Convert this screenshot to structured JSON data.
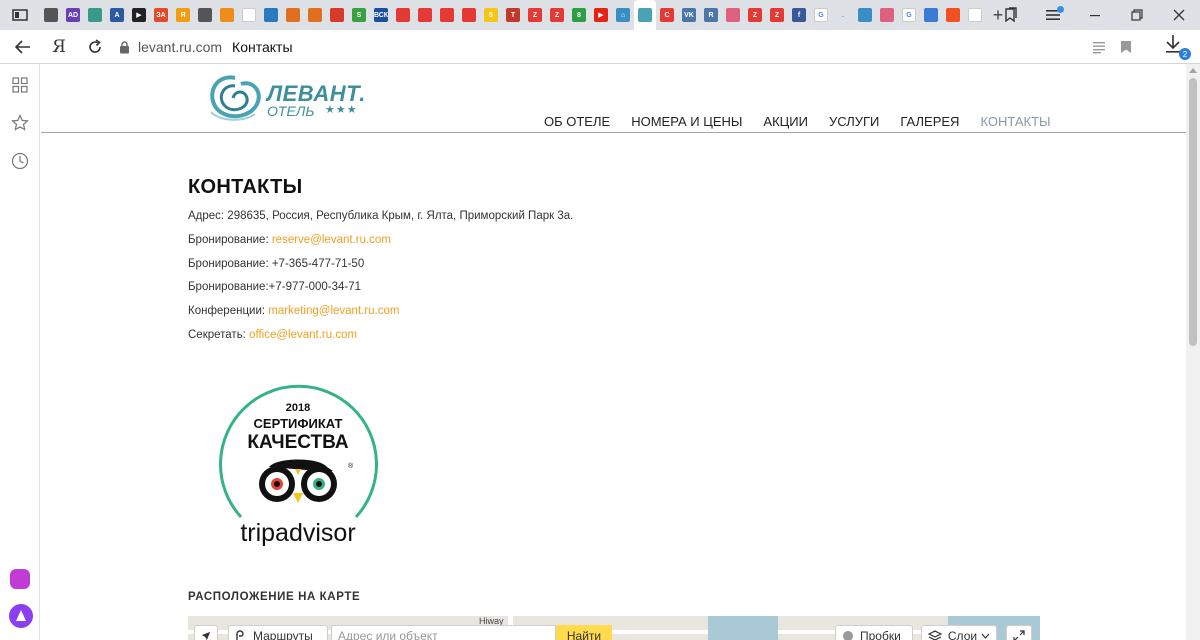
{
  "browser": {
    "address": {
      "domain": "levant.ru.com",
      "title": "Контакты",
      "yandex_label": "Я"
    },
    "download_count": "2",
    "favicons": [
      {
        "name": "tab-favicon-1",
        "color": "#555555",
        "glyph": ""
      },
      {
        "name": "tab-favicon-ad",
        "color": "#6a3fb5",
        "glyph": "AD"
      },
      {
        "name": "tab-favicon-circle",
        "color": "#3a9a8a",
        "glyph": ""
      },
      {
        "name": "tab-favicon-a",
        "color": "#2a5aa0",
        "glyph": "A"
      },
      {
        "name": "tab-favicon-play",
        "color": "#222222",
        "glyph": "▶"
      },
      {
        "name": "tab-favicon-za",
        "color": "#e24a2a",
        "glyph": "ЗА"
      },
      {
        "name": "tab-favicon-orange",
        "color": "#f39c12",
        "glyph": "Я"
      },
      {
        "name": "tab-favicon-cat",
        "color": "#555555",
        "glyph": ""
      },
      {
        "name": "tab-favicon-rss",
        "color": "#f08c1a",
        "glyph": ""
      },
      {
        "name": "tab-favicon-blank",
        "color": "#ffffff",
        "glyph": ""
      },
      {
        "name": "tab-favicon-chart",
        "color": "#2a7ac0",
        "glyph": ""
      },
      {
        "name": "tab-favicon-gear",
        "color": "#e07020",
        "glyph": ""
      },
      {
        "name": "tab-favicon-gear2",
        "color": "#e07020",
        "glyph": ""
      },
      {
        "name": "tab-favicon-red",
        "color": "#d83a2a",
        "glyph": ""
      },
      {
        "name": "tab-favicon-green",
        "color": "#3aa040",
        "glyph": "S"
      },
      {
        "name": "tab-favicon-vsk",
        "color": "#1b4f9c",
        "glyph": "ВСК"
      },
      {
        "name": "tab-favicon-red-o1",
        "color": "#e53935",
        "glyph": ""
      },
      {
        "name": "tab-favicon-red-o2",
        "color": "#e53935",
        "glyph": ""
      },
      {
        "name": "tab-favicon-red-o3",
        "color": "#e53935",
        "glyph": ""
      },
      {
        "name": "tab-favicon-red-o4",
        "color": "#e53935",
        "glyph": ""
      },
      {
        "name": "tab-favicon-5",
        "color": "#f5c518",
        "glyph": "5"
      },
      {
        "name": "tab-favicon-t",
        "color": "#c0392b",
        "glyph": "T"
      },
      {
        "name": "tab-favicon-z1",
        "color": "#e53935",
        "glyph": "Z"
      },
      {
        "name": "tab-favicon-z2",
        "color": "#e53935",
        "glyph": "Z"
      },
      {
        "name": "tab-favicon-8",
        "color": "#2e9e44",
        "glyph": "8"
      },
      {
        "name": "tab-favicon-youtube",
        "color": "#e62117",
        "glyph": "▶"
      },
      {
        "name": "tab-favicon-home",
        "color": "#3a8ec6",
        "glyph": "⌂"
      },
      {
        "name": "tab-favicon-levant",
        "color": "#4aa3b5",
        "glyph": ""
      },
      {
        "name": "tab-favicon-c",
        "color": "#e53935",
        "glyph": "C"
      },
      {
        "name": "tab-favicon-vk",
        "color": "#4a76a8",
        "glyph": "VK"
      },
      {
        "name": "tab-favicon-r",
        "color": "#4a76a8",
        "glyph": "R"
      },
      {
        "name": "tab-favicon-flower",
        "color": "#e06080",
        "glyph": ""
      },
      {
        "name": "tab-favicon-z3",
        "color": "#e53935",
        "glyph": "Z"
      },
      {
        "name": "tab-favicon-z4",
        "color": "#e53935",
        "glyph": "Z"
      },
      {
        "name": "tab-favicon-facebook",
        "color": "#3b5998",
        "glyph": "f"
      },
      {
        "name": "tab-favicon-google",
        "color": "#ffffff",
        "glyph": "G"
      },
      {
        "name": "tab-favicon-dot",
        "color": "#dee1e6",
        "glyph": "."
      },
      {
        "name": "tab-favicon-leaf",
        "color": "#3a8ec6",
        "glyph": ""
      },
      {
        "name": "tab-favicon-flower2",
        "color": "#e06080",
        "glyph": ""
      },
      {
        "name": "tab-favicon-google2",
        "color": "#ffffff",
        "glyph": "G"
      },
      {
        "name": "tab-favicon-chat",
        "color": "#3a7bd5",
        "glyph": ""
      },
      {
        "name": "tab-favicon-ms",
        "color": "#f25022",
        "glyph": ""
      },
      {
        "name": "tab-favicon-doc",
        "color": "#ffffff",
        "glyph": ""
      }
    ]
  },
  "site": {
    "logo": {
      "line1": "ЛЕВАНТ.",
      "line2": "ОТЕЛЬ",
      "stars": "★★★"
    },
    "nav": [
      {
        "label": "ОБ ОТЕЛЕ",
        "current": false
      },
      {
        "label": "НОМЕРА И ЦЕНЫ",
        "current": false
      },
      {
        "label": "АКЦИИ",
        "current": false
      },
      {
        "label": "УСЛУГИ",
        "current": false
      },
      {
        "label": "ГАЛЕРЕЯ",
        "current": false
      },
      {
        "label": "КОНТАКТЫ",
        "current": true
      }
    ]
  },
  "contacts": {
    "heading": "КОНТАКТЫ",
    "lines": [
      {
        "label": "Адрес: 298635, Россия, Республика Крым, г. Ялта, Приморский Парк 3а.",
        "link": ""
      },
      {
        "label": "Бронирование: ",
        "link": "reserve@levant.ru.com"
      },
      {
        "label": "Бронирование: +7-365-477-71-50",
        "link": ""
      },
      {
        "label": "Бронирование:+7-977-000-34-71",
        "link": ""
      },
      {
        "label": "Конференции: ",
        "link": "marketing@levant.ru.com"
      },
      {
        "label": "Секретать: ",
        "link": "office@levant.ru.com"
      }
    ]
  },
  "badge": {
    "year": "2018",
    "line1": "СЕРТИФИКАТ",
    "line2": "КАЧЕСТВА",
    "brand": "tripadvisor",
    "registered": "®",
    "ring_color": "#34b28a"
  },
  "map": {
    "title": "РАСПОЛОЖЕНИЕ НА КАРТЕ",
    "routes_label": "Маршруты",
    "search_placeholder": "Адрес или объект",
    "find_label": "Найти",
    "traffic_label": "Пробки",
    "layers_label": "Слои",
    "street_label": "Hiway"
  },
  "colors": {
    "accent_link": "#f0a020",
    "brand": "#3e8f9a",
    "nav_current": "#8b9aa6"
  }
}
